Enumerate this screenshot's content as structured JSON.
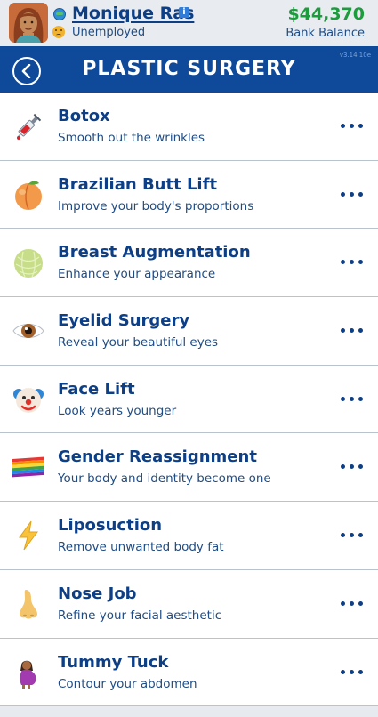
{
  "header": {
    "player_name": "Monique Ras",
    "job_status": "Unemployed",
    "balance": "$44,370",
    "balance_label": "Bank Balance",
    "info_glyph": "i"
  },
  "title_bar": {
    "title": "PLASTIC SURGERY",
    "version": "v3.14.10e"
  },
  "procedures": [
    {
      "title": "Botox",
      "description": "Smooth out the wrinkles",
      "icon": "syringe-icon"
    },
    {
      "title": "Brazilian Butt Lift",
      "description": "Improve your body's proportions",
      "icon": "peach-icon"
    },
    {
      "title": "Breast Augmentation",
      "description": "Enhance your appearance",
      "icon": "melon-icon"
    },
    {
      "title": "Eyelid Surgery",
      "description": "Reveal your beautiful eyes",
      "icon": "eye-icon"
    },
    {
      "title": "Face Lift",
      "description": "Look years younger",
      "icon": "clown-face-icon"
    },
    {
      "title": "Gender Reassignment",
      "description": "Your body and identity become one",
      "icon": "rainbow-flag-icon"
    },
    {
      "title": "Liposuction",
      "description": "Remove unwanted body fat",
      "icon": "lightning-icon"
    },
    {
      "title": "Nose Job",
      "description": "Refine your facial aesthetic",
      "icon": "nose-icon"
    },
    {
      "title": "Tummy Tuck",
      "description": "Contour your abdomen",
      "icon": "pregnant-woman-icon"
    }
  ],
  "colors": {
    "brand_blue": "#0f4a9a",
    "text_blue": "#0d3f86",
    "money_green": "#1c9c3c"
  }
}
